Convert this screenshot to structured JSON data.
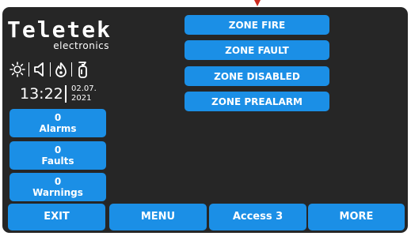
{
  "brand": {
    "logo": "Teletek",
    "tagline": "electronics"
  },
  "status_icons": [
    "sun-icon",
    "speaker-icon",
    "flame-icon",
    "extinguisher-icon"
  ],
  "clock": {
    "time": "13:22",
    "date_day_month": "02.07.",
    "date_year": "2021"
  },
  "counters": [
    {
      "value": "0",
      "label": "Alarms"
    },
    {
      "value": "0",
      "label": "Faults"
    },
    {
      "value": "0",
      "label": "Warnings"
    }
  ],
  "zone_buttons": [
    "ZONE FIRE",
    "ZONE FAULT",
    "ZONE DISABLED",
    "ZONE PREALARM"
  ],
  "bottom_bar": {
    "exit": "EXIT",
    "menu": "MENU",
    "access": "Access 3",
    "more": "MORE"
  },
  "colors": {
    "button_blue": "#1b8fe6",
    "screen_bg": "#262626",
    "text": "#ffffff",
    "marker_red": "#cc2a1e"
  }
}
